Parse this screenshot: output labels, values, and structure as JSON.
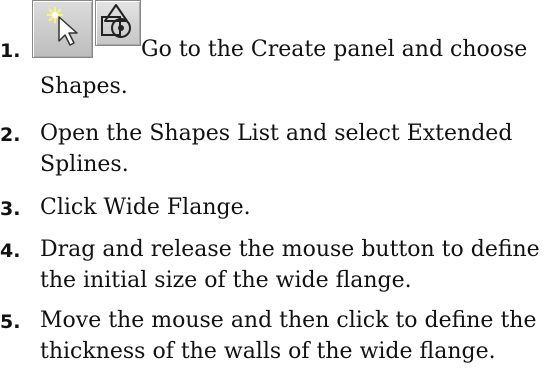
{
  "steps": [
    {
      "number": "1.",
      "line1": "Go to the Create panel and choose",
      "line2": "Shapes.",
      "icons": [
        "create-panel-icon",
        "shapes-icon"
      ]
    },
    {
      "number": "2.",
      "line1": "Open the Shapes List and select Extended",
      "line2": "Splines."
    },
    {
      "number": "3.",
      "line1": "Click Wide Flange."
    },
    {
      "number": "4.",
      "line1": "Drag and release the mouse button to define",
      "line2": "the initial size of the wide flange."
    },
    {
      "number": "5.",
      "line1": "Move the mouse and then click to define the",
      "line2": "thickness of the walls of the wide flange."
    }
  ],
  "colors": {
    "text": "#111111",
    "icon_face": "#c8c8c8",
    "icon_border": "#888888"
  }
}
